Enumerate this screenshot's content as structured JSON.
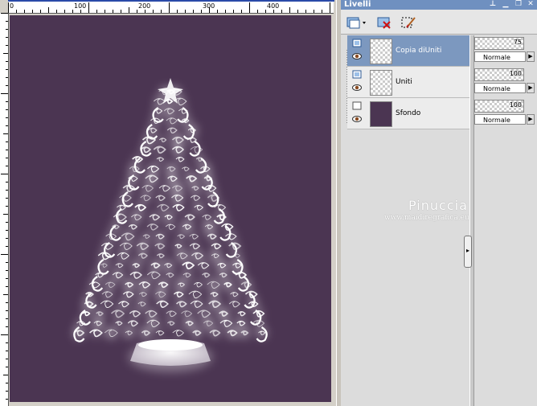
{
  "rulers": {
    "top_labels": [
      "0",
      "100",
      "200",
      "300",
      "400"
    ]
  },
  "panel": {
    "title": "Livelli",
    "title_buttons": [
      "pin-icon",
      "minimize-icon",
      "restore-icon",
      "close-icon"
    ]
  },
  "toolbar": {
    "new_layer_icon": "new-raster-layer-icon",
    "delete_layer_icon": "delete-layer-icon",
    "edit_selection_icon": "edit-selection-icon"
  },
  "layers": [
    {
      "name": "Copia diUniti",
      "opacity": "75",
      "blend": "Normale",
      "selected": true
    },
    {
      "name": "Uniti",
      "opacity": "100",
      "blend": "Normale",
      "selected": false
    },
    {
      "name": "Sfondo",
      "opacity": "100",
      "blend": "Normale",
      "selected": false
    }
  ],
  "watermark": {
    "name": "Pinuccia",
    "url": "www.maidiregrafica.eu"
  },
  "colors": {
    "canvas_bg": "#4b3552",
    "selected_row": "#7c98bf",
    "title_bar": "#6f90c0"
  }
}
